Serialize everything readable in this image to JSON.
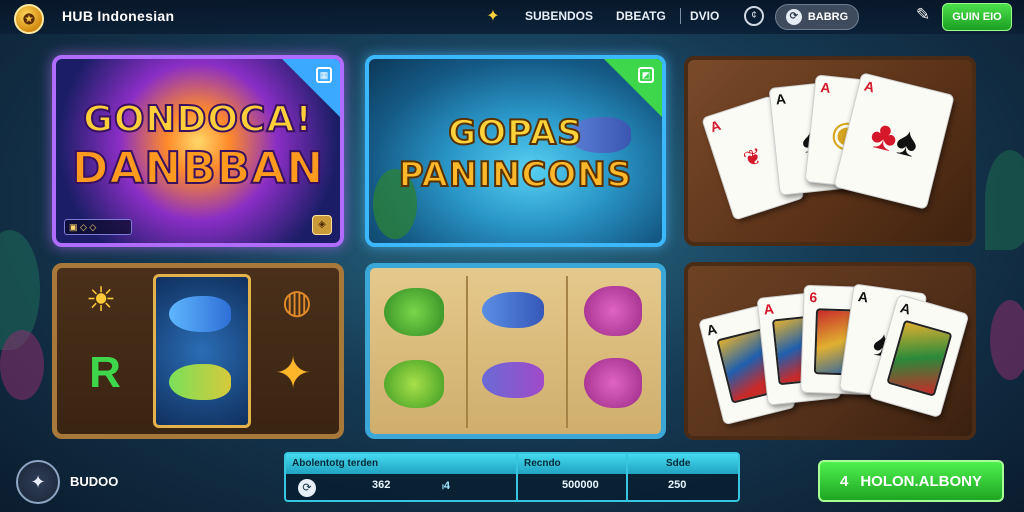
{
  "header": {
    "logo_glyph": "✪",
    "title": "HUB Indonesian",
    "nav_links": [
      "SUBENDOS",
      "DBEATG",
      "DVIO"
    ],
    "coin_badge": "¢",
    "pill_label": "BABRG",
    "cta_label": "GUIN EIO"
  },
  "games": {
    "featured1": {
      "title_line1": "GONDOCA!",
      "title_line2": "DANBBAN",
      "mini_label": "▣ ◇ ◇",
      "mini_btn": "◈",
      "ribbon_icon": "▦",
      "ribbon_color": "#3aa9ff"
    },
    "featured2": {
      "title_line1": "GOPAS",
      "title_line2": "PANINCONS",
      "ribbon_icon": "◩",
      "ribbon_color": "#3ed64a"
    },
    "cards1": {
      "cards": [
        {
          "rank": "A",
          "suit": "♠"
        },
        {
          "rank": "A",
          "suit": "♦"
        },
        {
          "rank": "A",
          "suit": "♠"
        },
        {
          "rank": "",
          "suit": "♣♠"
        }
      ]
    },
    "slots1": {
      "symbols": [
        "☀",
        "R",
        "✦"
      ]
    },
    "slots2": {},
    "cards2": {
      "cards": [
        {
          "rank": "A",
          "suit": "♠"
        },
        {
          "rank": "A",
          "suit": "♥"
        },
        {
          "rank": "6",
          "suit": "♥"
        },
        {
          "rank": "A",
          "suit": "♠"
        },
        {
          "rank": "A",
          "suit": "♠"
        }
      ]
    }
  },
  "footer": {
    "avatar_glyph": "✦",
    "username": "BUDOO",
    "stats": {
      "col1_header": "Abolentotg terden",
      "col2_header": "Recndo",
      "col3_header": "Sdde",
      "col1_value": "362",
      "col1b_value": "ₗ4",
      "col2_value": "500000",
      "col3_value": "250"
    },
    "cta_icon": "4",
    "cta_label": "HOLON.ALBONY"
  },
  "colors": {
    "accent_green": "#1ea622",
    "accent_cyan": "#36c6e0",
    "featured1_border": "#b06cff"
  }
}
